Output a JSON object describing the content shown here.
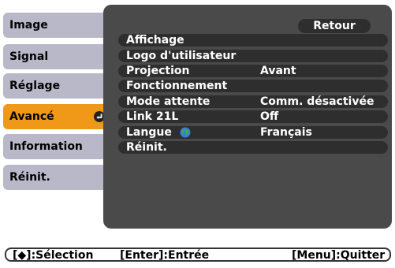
{
  "tabs": [
    {
      "label": "Image"
    },
    {
      "label": "Signal"
    },
    {
      "label": "Réglage"
    },
    {
      "label": "Avancé"
    },
    {
      "label": "Information"
    },
    {
      "label": "Réinit."
    }
  ],
  "menu": {
    "back_label": "Retour",
    "rows": [
      {
        "label": "Affichage",
        "value": ""
      },
      {
        "label": "Logo d'utilisateur",
        "value": ""
      },
      {
        "label": "Projection",
        "value": "Avant"
      },
      {
        "label": "Fonctionnement",
        "value": ""
      },
      {
        "label": "Mode attente",
        "value": "Comm. désactivée"
      },
      {
        "label": "Link 21L",
        "value": "Off"
      },
      {
        "label": "Langue",
        "value": "Français"
      },
      {
        "label": "Réinit.",
        "value": ""
      }
    ]
  },
  "status_bar": {
    "select": "[◆]:Sélection",
    "enter": "[Enter]:Entrée",
    "quit": "[Menu]:Quitter"
  },
  "colors": {
    "active_tab": "#f09818",
    "tab": "#b8b8c8",
    "panel": "#4a4a4a",
    "row": "#2e2e2e"
  }
}
